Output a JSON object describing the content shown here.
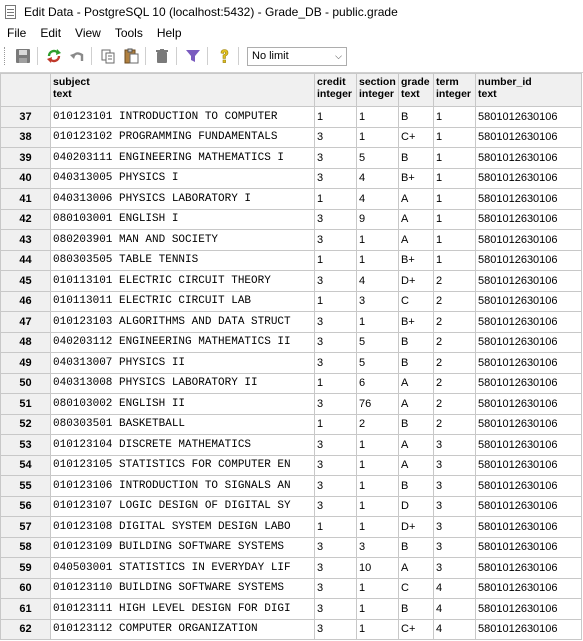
{
  "window": {
    "title": "Edit Data - PostgreSQL 10 (localhost:5432) - Grade_DB - public.grade"
  },
  "menu": [
    "File",
    "Edit",
    "View",
    "Tools",
    "Help"
  ],
  "toolbar": {
    "limit_value": "No limit",
    "icons": [
      "save-icon",
      "refresh-icon",
      "undo-icon",
      "copy-icon",
      "paste-icon",
      "delete-icon",
      "filter-icon",
      "help-icon"
    ]
  },
  "grid": {
    "columns": [
      {
        "name": "subject",
        "type": "text"
      },
      {
        "name": "credit",
        "type": "integer"
      },
      {
        "name": "section",
        "type": "integer"
      },
      {
        "name": "grade",
        "type": "text"
      },
      {
        "name": "term",
        "type": "integer"
      },
      {
        "name": "number_id",
        "type": "text"
      }
    ],
    "rows": [
      {
        "n": "37",
        "subject": "010123101 INTRODUCTION TO COMPUTER",
        "credit": "1",
        "section": "1",
        "grade": "B",
        "term": "1",
        "number_id": "5801012630106"
      },
      {
        "n": "38",
        "subject": "010123102 PROGRAMMING FUNDAMENTALS",
        "credit": "3",
        "section": "1",
        "grade": "C+",
        "term": "1",
        "number_id": "5801012630106"
      },
      {
        "n": "39",
        "subject": "040203111 ENGINEERING MATHEMATICS I",
        "credit": "3",
        "section": "5",
        "grade": "B",
        "term": "1",
        "number_id": "5801012630106"
      },
      {
        "n": "40",
        "subject": "040313005 PHYSICS I",
        "credit": "3",
        "section": "4",
        "grade": "B+",
        "term": "1",
        "number_id": "5801012630106"
      },
      {
        "n": "41",
        "subject": "040313006 PHYSICS LABORATORY I",
        "credit": "1",
        "section": "4",
        "grade": "A",
        "term": "1",
        "number_id": "5801012630106"
      },
      {
        "n": "42",
        "subject": "080103001 ENGLISH I",
        "credit": "3",
        "section": "9",
        "grade": "A",
        "term": "1",
        "number_id": "5801012630106"
      },
      {
        "n": "43",
        "subject": "080203901 MAN AND SOCIETY",
        "credit": "3",
        "section": "1",
        "grade": "A",
        "term": "1",
        "number_id": "5801012630106"
      },
      {
        "n": "44",
        "subject": "080303505 TABLE TENNIS",
        "credit": "1",
        "section": "1",
        "grade": "B+",
        "term": "1",
        "number_id": "5801012630106"
      },
      {
        "n": "45",
        "subject": "010113101 ELECTRIC CIRCUIT THEORY",
        "credit": "3",
        "section": "4",
        "grade": "D+",
        "term": "2",
        "number_id": "5801012630106"
      },
      {
        "n": "46",
        "subject": "010113011 ELECTRIC CIRCUIT LAB",
        "credit": "1",
        "section": "3",
        "grade": "C",
        "term": "2",
        "number_id": "5801012630106"
      },
      {
        "n": "47",
        "subject": "010123103 ALGORITHMS AND DATA STRUCT",
        "credit": "3",
        "section": "1",
        "grade": "B+",
        "term": "2",
        "number_id": "5801012630106"
      },
      {
        "n": "48",
        "subject": "040203112 ENGINEERING MATHEMATICS II",
        "credit": "3",
        "section": "5",
        "grade": "B",
        "term": "2",
        "number_id": "5801012630106"
      },
      {
        "n": "49",
        "subject": "040313007 PHYSICS II",
        "credit": "3",
        "section": "5",
        "grade": "B",
        "term": "2",
        "number_id": "5801012630106"
      },
      {
        "n": "50",
        "subject": "040313008 PHYSICS LABORATORY II",
        "credit": "1",
        "section": "6",
        "grade": "A",
        "term": "2",
        "number_id": "5801012630106"
      },
      {
        "n": "51",
        "subject": "080103002 ENGLISH II",
        "credit": "3",
        "section": "76",
        "grade": "A",
        "term": "2",
        "number_id": "5801012630106"
      },
      {
        "n": "52",
        "subject": "080303501 BASKETBALL",
        "credit": "1",
        "section": "2",
        "grade": "B",
        "term": "2",
        "number_id": "5801012630106"
      },
      {
        "n": "53",
        "subject": "010123104 DISCRETE MATHEMATICS",
        "credit": "3",
        "section": "1",
        "grade": "A",
        "term": "3",
        "number_id": "5801012630106"
      },
      {
        "n": "54",
        "subject": "010123105 STATISTICS FOR COMPUTER EN",
        "credit": "3",
        "section": "1",
        "grade": "A",
        "term": "3",
        "number_id": "5801012630106"
      },
      {
        "n": "55",
        "subject": "010123106 INTRODUCTION TO SIGNALS AN",
        "credit": "3",
        "section": "1",
        "grade": "B",
        "term": "3",
        "number_id": "5801012630106"
      },
      {
        "n": "56",
        "subject": "010123107 LOGIC DESIGN OF DIGITAL SY",
        "credit": "3",
        "section": "1",
        "grade": "D",
        "term": "3",
        "number_id": "5801012630106"
      },
      {
        "n": "57",
        "subject": "010123108 DIGITAL SYSTEM DESIGN LABO",
        "credit": "1",
        "section": "1",
        "grade": "D+",
        "term": "3",
        "number_id": "5801012630106"
      },
      {
        "n": "58",
        "subject": "010123109 BUILDING SOFTWARE SYSTEMS",
        "credit": "3",
        "section": "3",
        "grade": "B",
        "term": "3",
        "number_id": "5801012630106"
      },
      {
        "n": "59",
        "subject": "040503001 STATISTICS IN EVERYDAY LIF",
        "credit": "3",
        "section": "10",
        "grade": "A",
        "term": "3",
        "number_id": "5801012630106"
      },
      {
        "n": "60",
        "subject": "010123110 BUILDING SOFTWARE SYSTEMS",
        "credit": "3",
        "section": "1",
        "grade": "C",
        "term": "4",
        "number_id": "5801012630106"
      },
      {
        "n": "61",
        "subject": "010123111 HIGH LEVEL DESIGN FOR DIGI",
        "credit": "3",
        "section": "1",
        "grade": "B",
        "term": "4",
        "number_id": "5801012630106"
      },
      {
        "n": "62",
        "subject": "010123112 COMPUTER ORGANIZATION",
        "credit": "3",
        "section": "1",
        "grade": "C+",
        "term": "4",
        "number_id": "5801012630106"
      }
    ]
  },
  "colors": {
    "header_bg": "#f0f0f0",
    "grid_line": "#c8c8c8",
    "save_red": "#c0392b",
    "refresh_green": "#2e9e2e",
    "filter_purple": "#7a5bbf",
    "help_yellow": "#e0c020"
  }
}
